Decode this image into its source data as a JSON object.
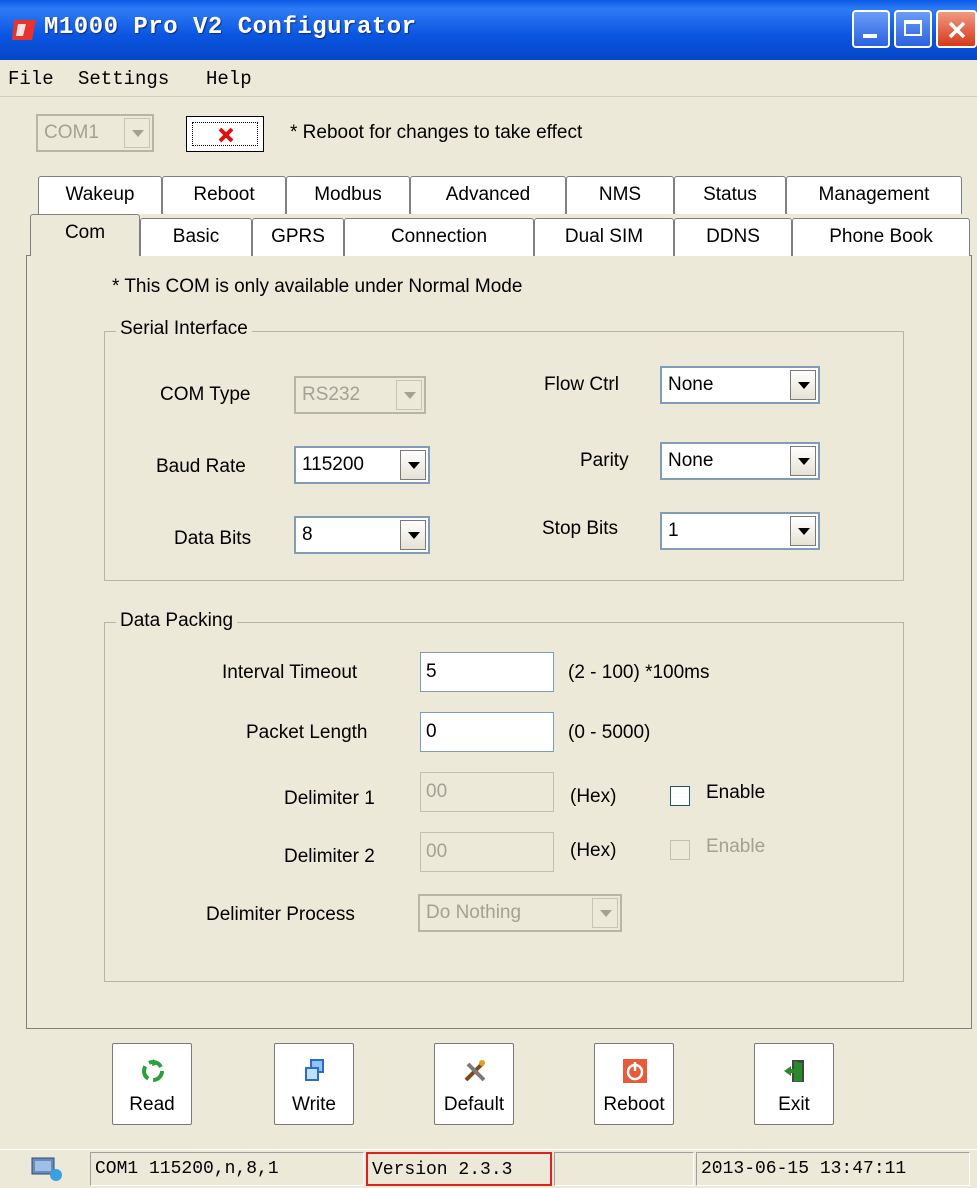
{
  "window": {
    "title": "M1000 Pro V2 Configurator"
  },
  "menu": [
    "File",
    "Settings",
    "Help"
  ],
  "toolbar": {
    "port": "COM1",
    "note": "* Reboot for changes to take effect"
  },
  "tabs": {
    "row_back": [
      "Wakeup",
      "Reboot",
      "Modbus",
      "Advanced",
      "NMS",
      "Status",
      "Management"
    ],
    "row_front": [
      "Com",
      "Basic",
      "GPRS",
      "Connection",
      "Dual SIM",
      "DDNS",
      "Phone Book"
    ],
    "active": "Com"
  },
  "com": {
    "notice": "* This COM is only available under Normal Mode",
    "serial": {
      "title": "Serial Interface",
      "com_type_label": "COM Type",
      "com_type": "RS232",
      "baud_label": "Baud Rate",
      "baud": "115200",
      "data_bits_label": "Data Bits",
      "data_bits": "8",
      "flow_label": "Flow Ctrl",
      "flow": "None",
      "parity_label": "Parity",
      "parity": "None",
      "stop_label": "Stop Bits",
      "stop": "1"
    },
    "packing": {
      "title": "Data Packing",
      "interval_label": "Interval Timeout",
      "interval": "5",
      "interval_hint": "(2 - 100) *100ms",
      "length_label": "Packet Length",
      "length": "0",
      "length_hint": "(0 - 5000)",
      "delim1_label": "Delimiter 1",
      "delim1": "00",
      "delim1_hint": "(Hex)",
      "delim1_enable": "Enable",
      "delim2_label": "Delimiter 2",
      "delim2": "00",
      "delim2_hint": "(Hex)",
      "delim2_enable": "Enable",
      "process_label": "Delimiter Process",
      "process": "Do Nothing"
    }
  },
  "actions": [
    "Read",
    "Write",
    "Default",
    "Reboot",
    "Exit"
  ],
  "status": {
    "port": "COM1 115200,n,8,1",
    "version": "Version 2.3.3",
    "datetime": "2013-06-15 13:47:11",
    "highlight_color": "#e02020"
  }
}
